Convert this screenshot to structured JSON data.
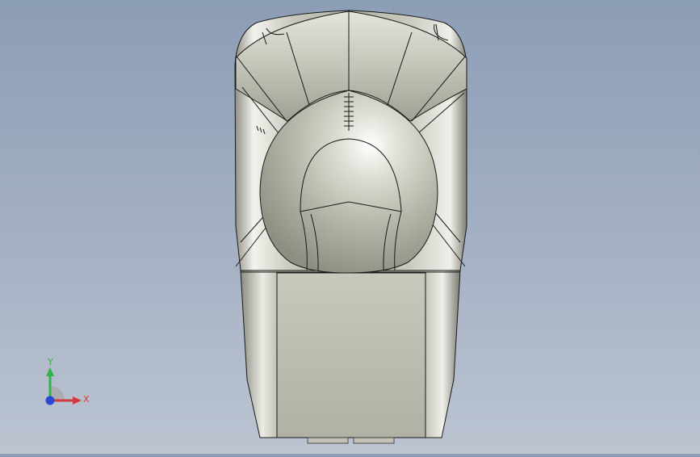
{
  "viewport": {
    "background_top": "#8c9db6",
    "background_bottom": "#bcc4d1",
    "model_fill": "#b9b9ae",
    "model_highlight": "#f3f3ee",
    "edge_color": "#1a1a1a"
  },
  "triad": {
    "x_label": "X",
    "y_label": "Y",
    "x_color": "#d43a3a",
    "y_color": "#2fb34a",
    "z_color": "#2b47d6"
  }
}
